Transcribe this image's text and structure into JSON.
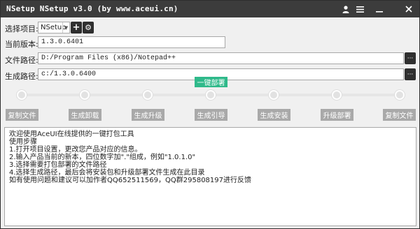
{
  "window": {
    "title": "NSetup NSetup v3.0 (by www.aceui.cn)",
    "icons": [
      "user-icon",
      "menu-icon",
      "minimize-icon",
      "close-icon"
    ]
  },
  "form": {
    "project_label": "选择项目:",
    "project_value": "NSetup",
    "version_label": "当前版本:",
    "version_value": "1.3.0.6401",
    "file_path_label": "文件路径:",
    "file_path_value": "D:/Program Files (x86)/Notepad++",
    "output_path_label": "生成路径:",
    "output_path_value": "c:/1.3.0.6400",
    "more_label": "···",
    "add_symbol": "+",
    "settings_symbol": "⚙"
  },
  "actions": {
    "one_click_deploy": "一键部署"
  },
  "steps": [
    "复制文件",
    "生成卸载",
    "生成升级",
    "生成引导",
    "生成安装",
    "升级部署",
    "复制文件"
  ],
  "log": {
    "lines": [
      "欢迎使用AceUI在线提供的一键打包工具",
      "使用步骤",
      "1.打开项目设置，更改您产品对应的信息。",
      "2.输入产品当前的新本，四位数字加\".\"组成，例如\"1.0.1.0\"",
      "3.选择需要打包部署的文件路径",
      "4.选择生成路径，最后会将安装包和升级部署文件生成在此目录",
      "如有使用问题和建议可以加作者QQ652511569，QQ群295808197进行反馈"
    ]
  },
  "colors": {
    "titlebar": "#3c3c3c",
    "accent_green": "#2fb98a",
    "step_button": "#a9a9a9"
  }
}
